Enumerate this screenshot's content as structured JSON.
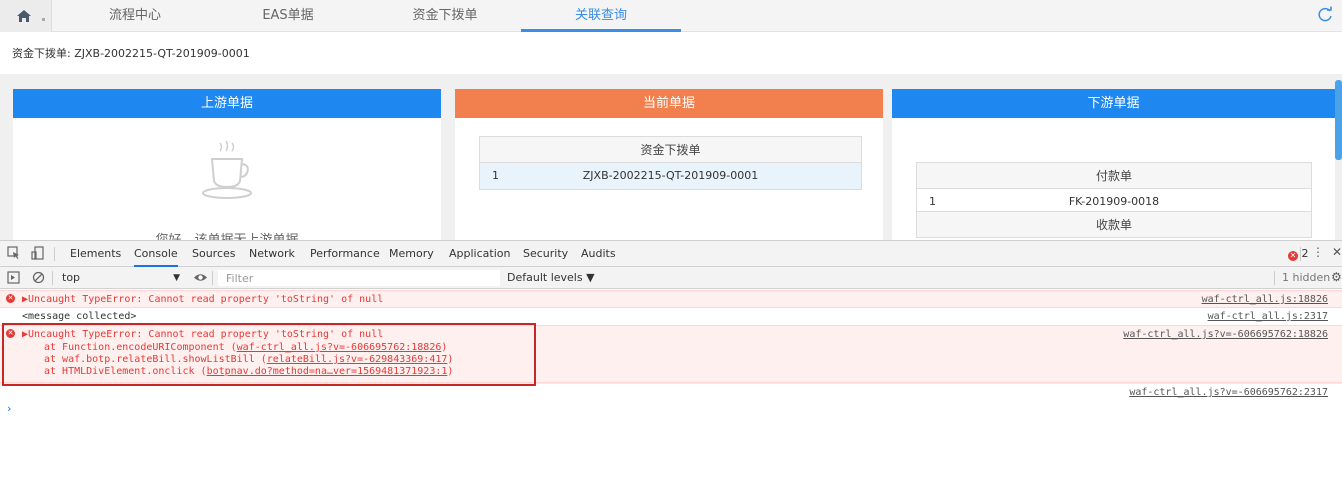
{
  "top_tabs": {
    "home_icon": "home-icon",
    "tabs": [
      {
        "label": "流程中心",
        "active": false
      },
      {
        "label": "EAS单据",
        "active": false
      },
      {
        "label": "资金下拨单",
        "active": false
      },
      {
        "label": "关联查询",
        "active": true
      }
    ],
    "refresh_icon": "refresh-icon"
  },
  "header": {
    "bill_label": "资金下拨单: ZJXB-2002215-QT-201909-0001"
  },
  "panels": {
    "upstream": {
      "title": "上游单据",
      "empty_icon": "coffee-cup-icon",
      "empty_text": "您好，该单据无上游单据"
    },
    "current": {
      "title": "当前单据",
      "table_title": "资金下拨单",
      "rows": [
        {
          "num": "1",
          "value": "ZJXB-2002215-QT-201909-0001"
        }
      ]
    },
    "downstream": {
      "title": "下游单据",
      "table1_title": "付款单",
      "rows": [
        {
          "num": "1",
          "value": "FK-201909-0018"
        }
      ],
      "table2_title": "收款单"
    }
  },
  "devtools": {
    "tabs": [
      "Elements",
      "Console",
      "Sources",
      "Network",
      "Performance",
      "Memory",
      "Application",
      "Security",
      "Audits"
    ],
    "active_tab": "Console",
    "error_count": "2",
    "toolbar": {
      "context": "top",
      "filter_placeholder": "Filter",
      "levels": "Default levels ▼",
      "hidden": "1 hidden"
    },
    "logs": [
      {
        "type": "error",
        "message": "▶Uncaught TypeError: Cannot read property 'toString' of null",
        "source": "waf-ctrl_all.js:18826"
      },
      {
        "type": "info",
        "message": "<message collected>",
        "source": "waf-ctrl_all.js:2317"
      },
      {
        "type": "error",
        "message": "▶Uncaught TypeError: Cannot read property 'toString' of null",
        "source": "waf-ctrl_all.js?v=-606695762:18826",
        "stack": [
          {
            "prefix": "at Function.encodeURIComponent (",
            "link": "waf-ctrl_all.js?v=-606695762:18826",
            "suffix": ")"
          },
          {
            "prefix": "at waf.botp.relateBill.showListBill (",
            "link": "relateBill.js?v=-629843369:417",
            "suffix": ")"
          },
          {
            "prefix": "at HTMLDivElement.onclick (",
            "link": "botpnav.do?method=na…ver=1569481371923:1",
            "suffix": ")"
          }
        ]
      },
      {
        "type": "info",
        "message": "",
        "source": "waf-ctrl_all.js?v=-606695762:2317"
      }
    ],
    "prompt": "›"
  },
  "colors": {
    "accent_blue": "#1e88f0",
    "accent_orange": "#f2804f",
    "active_tab": "#3a8ee6",
    "error_red": "#e53935"
  }
}
